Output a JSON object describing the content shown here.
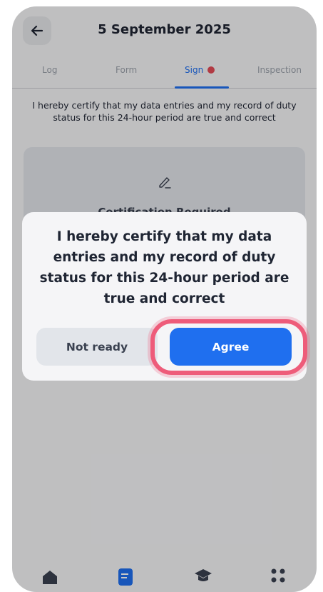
{
  "header": {
    "title": "5 September 2025"
  },
  "tabs": [
    {
      "label": "Log"
    },
    {
      "label": "Form"
    },
    {
      "label": "Sign"
    },
    {
      "label": "Inspection"
    }
  ],
  "certify_text": "I hereby certify that my data entries and my record of duty status for this 24-hour period are true and correct",
  "signature_box": {
    "label": "Certification Required"
  },
  "dialog": {
    "text": "I hereby certify that my data entries and my record of duty status for this 24-hour period are true and correct",
    "not_ready_label": "Not ready",
    "agree_label": "Agree"
  },
  "colors": {
    "accent": "#1f6fef",
    "alert_dot": "#e34b56",
    "highlight": "#ee5c7a"
  },
  "icons": [
    "back-arrow-icon",
    "pen-icon",
    "home-icon",
    "logs-icon",
    "graduation-cap-icon",
    "grid-icon"
  ]
}
